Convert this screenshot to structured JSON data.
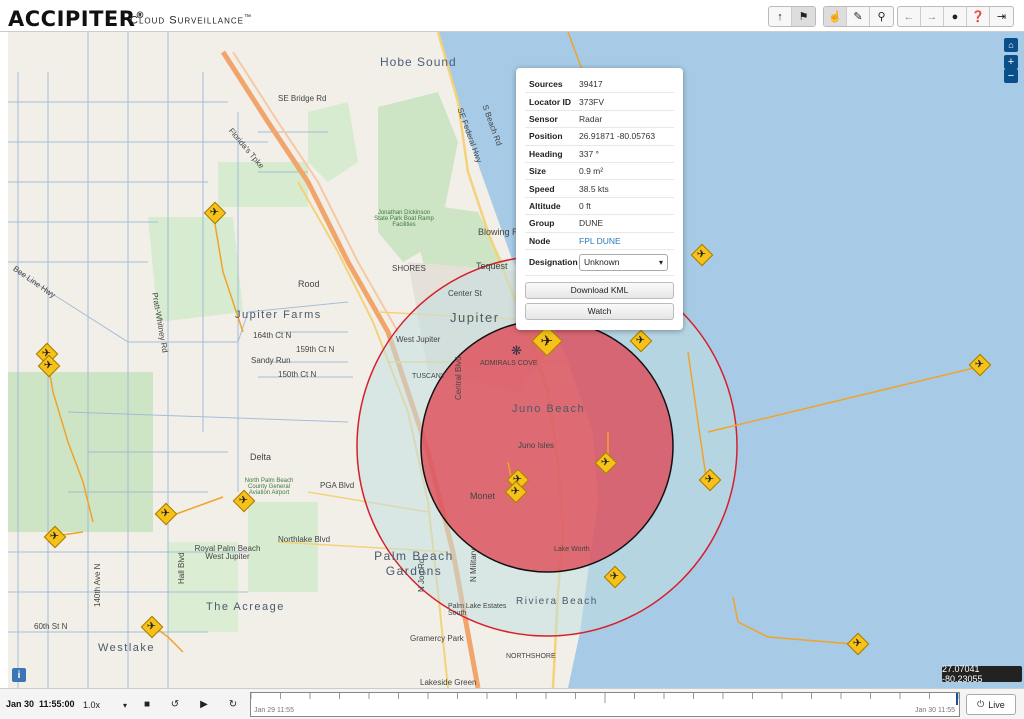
{
  "header": {
    "logo": "ACCIPITER",
    "logo_tm": "®",
    "subtitle": "Cloud Surveillance",
    "subtitle_tm": "™",
    "toolbar_icons": [
      "upload-arrow-icon",
      "tag-icon",
      "pointer-hand-icon",
      "ruler-icon",
      "location-pin-icon",
      "back-arrow-icon",
      "forward-arrow-icon",
      "record-dot-icon",
      "help-icon",
      "logout-icon"
    ]
  },
  "map": {
    "labels": {
      "hobe_sound": "Hobe Sound",
      "se_bridge_rd": "SE Bridge Rd",
      "floridas_tpke": "Florida's Tpke",
      "se_federal_hwy": "SE Federal Hwy",
      "s_beach_rd": "S Beach Rd",
      "jonathan_dickinson": "Jonathan Dickinson State Park Boat Ramp Facilities",
      "blowing_rock": "Blowing R",
      "tequesta": "Tequest",
      "shores": "SHORES",
      "rood": "Rood",
      "center_st": "Center St",
      "jupiter_farms": "Jupiter Farms",
      "jupiter": "Jupiter",
      "west_jupiter": "West Jupiter",
      "ct_164th": "164th Ct N",
      "ct_159th": "159th Ct N",
      "sandy_run": "Sandy Run",
      "ct_150th": "150th Ct N",
      "admirals_cove": "ADMIRALS COVE",
      "tuscany": "TUSCANY",
      "juno_beach": "Juno Beach",
      "juno_isles": "Juno Isles",
      "central_blvd": "Central Blvd",
      "bee_line_hwy": "Bee Line Hwy",
      "pratt_whitney": "Pratt-Whitney Rd",
      "delta": "Delta",
      "airport": "North Palm Beach County General Aviation Airport",
      "pga_blvd": "PGA Blvd",
      "monet": "Monet",
      "northlake": "Northlake Blvd",
      "royal_palm": "Royal Palm Beach West Jupiter",
      "palm_beach_gardens": "Palm Beach Gardens",
      "the_acreage": "The Acreage",
      "hall_blvd": "Hall Blvd",
      "ave_140th": "140th Ave N",
      "st_60th": "60th St N",
      "westlake": "Westlake",
      "riviera_beach": "Riviera Beach",
      "palm_lake_estates": "Palm Lake Estates South",
      "gramercy_park": "Gramercy Park",
      "northshore": "NORTHSHORE",
      "lakeside_green": "Lakeside Green",
      "lake_worth": "Lake Worth",
      "n_jog_rd": "N Jog Rd",
      "n_military": "N Military"
    },
    "zoom_in": "+",
    "zoom_out": "−",
    "info": "i",
    "coords": "27.07041 -80.23055"
  },
  "popup": {
    "rows": [
      {
        "key": "Sources",
        "value": "39417"
      },
      {
        "key": "Locator ID",
        "value": "373FV"
      },
      {
        "key": "Sensor",
        "value": "Radar"
      },
      {
        "key": "Position",
        "value": "26.91871 -80.05763"
      },
      {
        "key": "Heading",
        "value": "337 °"
      },
      {
        "key": "Size",
        "value": "0.9 m²"
      },
      {
        "key": "Speed",
        "value": "38.5 kts"
      },
      {
        "key": "Altitude",
        "value": "0 ft"
      },
      {
        "key": "Group",
        "value": "DUNE"
      },
      {
        "key": "Node",
        "value": "FPL DUNE"
      }
    ],
    "designation_label": "Designation",
    "designation_value": "Unknown",
    "download_kml": "Download KML",
    "watch": "Watch"
  },
  "bottombar": {
    "date": "Jan 30",
    "time": "11:55:00",
    "speed": "1.0x",
    "timeline_start": "Jan 29 11:55",
    "timeline_end": "Jan 30 11:55",
    "live": "Live"
  },
  "colors": {
    "water": "#a7cbe6",
    "park": "#cde5c5",
    "highway": "#f1a56b",
    "track": "#f0a32a",
    "plane": "#f6c21a",
    "zone_red": "#e0404f",
    "zone_outer": "#c3dfe0"
  }
}
